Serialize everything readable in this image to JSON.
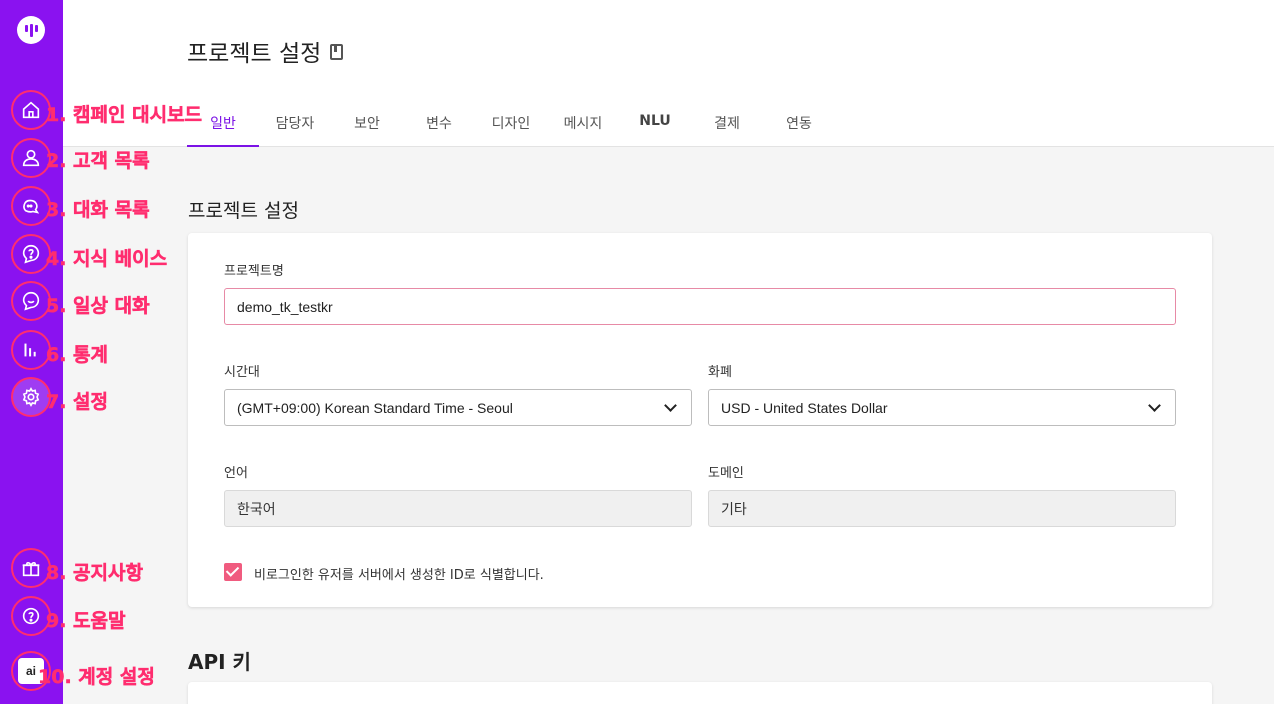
{
  "colors": {
    "sidebar": "#8a12f0",
    "accent": "#7b12e6",
    "annotation": "#ff2d6f",
    "checkbox": "#f05b7f"
  },
  "sidebar": {
    "items": [
      {
        "icon": "home-icon",
        "annotation": "1. 캠페인 대시보드"
      },
      {
        "icon": "user-icon",
        "annotation": "2. 고객 목록"
      },
      {
        "icon": "chat-icon",
        "annotation": "3. 대화 목록"
      },
      {
        "icon": "question-bubble-icon",
        "annotation": "4. 지식 베이스"
      },
      {
        "icon": "smile-bubble-icon",
        "annotation": "5. 일상 대화"
      },
      {
        "icon": "bar-chart-icon",
        "annotation": "6. 통계"
      },
      {
        "icon": "gear-icon",
        "annotation": "7. 설정"
      },
      {
        "icon": "gift-icon",
        "annotation": "8. 공지사항"
      },
      {
        "icon": "help-icon",
        "annotation": "9. 도움말"
      },
      {
        "icon": "account-avatar-icon",
        "annotation": "10. 계정 설정",
        "avatar_text": "ai"
      }
    ]
  },
  "header": {
    "title": "프로젝트 설정",
    "tabs": [
      {
        "label": "일반"
      },
      {
        "label": "담당자"
      },
      {
        "label": "보안"
      },
      {
        "label": "변수"
      },
      {
        "label": "디자인"
      },
      {
        "label": "메시지"
      },
      {
        "label": "NLU"
      },
      {
        "label": "결제"
      },
      {
        "label": "연동"
      }
    ]
  },
  "project_section": {
    "title": "프로젝트 설정",
    "name_label": "프로젝트명",
    "name_value": "demo_tk_testkr",
    "timezone_label": "시간대",
    "timezone_value": "(GMT+09:00) Korean Standard Time - Seoul",
    "currency_label": "화폐",
    "currency_value": "USD - United States Dollar",
    "language_label": "언어",
    "language_value": "한국어",
    "domain_label": "도메인",
    "domain_value": "기타",
    "checkbox_label": "비로그인한 유저를 서버에서 생성한 ID로 식별합니다.",
    "checkbox_checked": true
  },
  "api_section": {
    "title": "API 키"
  }
}
